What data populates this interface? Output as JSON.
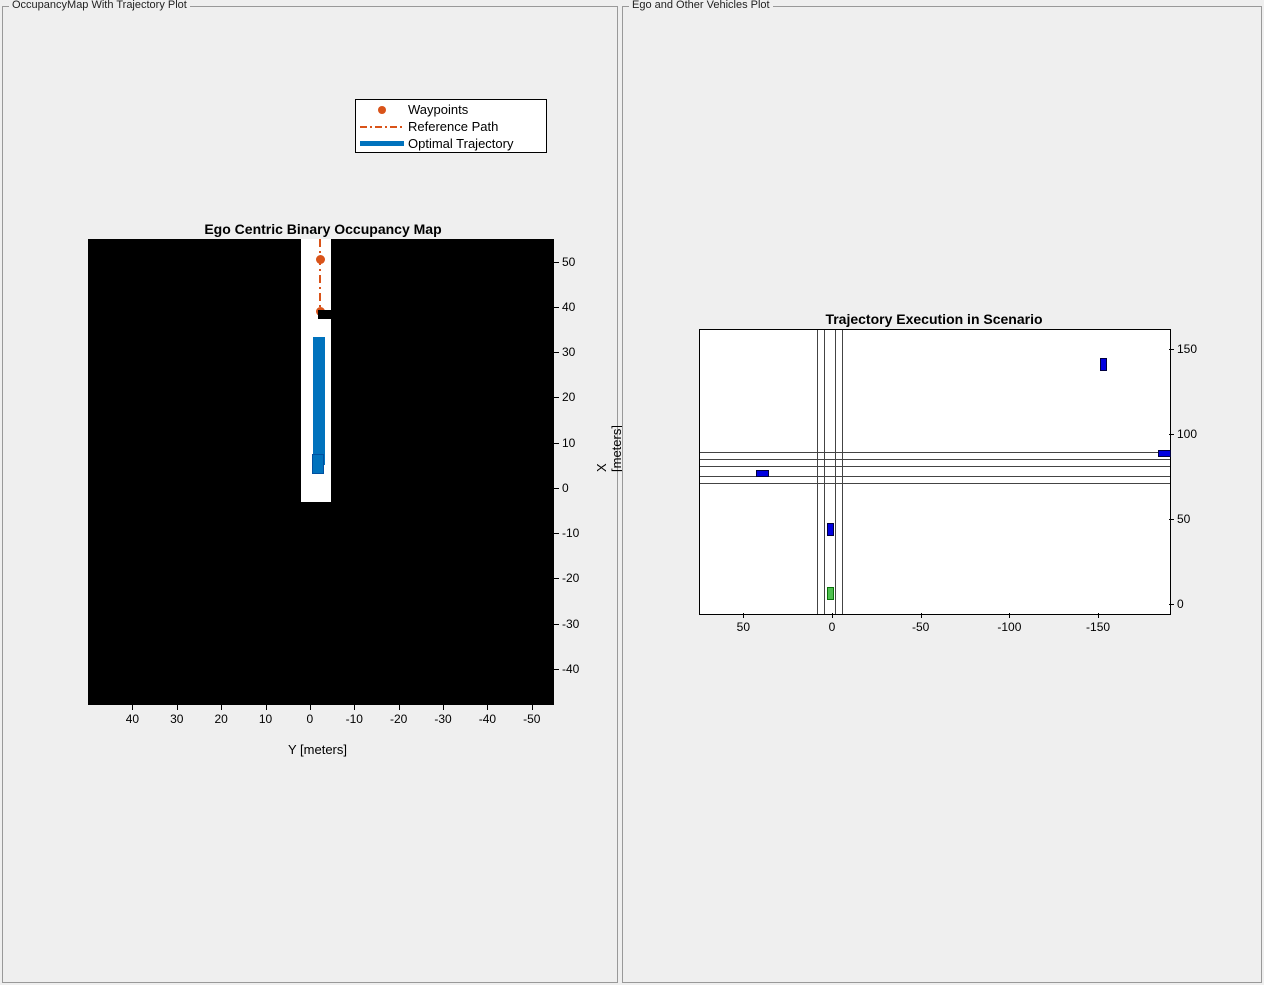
{
  "panels": {
    "left_title": "OccupancyMap With Trajectory Plot",
    "right_title": "Ego and Other Vehicles Plot"
  },
  "legend": {
    "items": [
      "Waypoints",
      "Reference Path",
      "Optimal Trajectory"
    ]
  },
  "occupancy": {
    "title": "Ego Centric Binary Occupancy Map",
    "xlabel": "Y [meters]",
    "ylabel": "X [meters]",
    "x_ticks": [
      "40",
      "30",
      "20",
      "10",
      "0",
      "-10",
      "-20",
      "-30",
      "-40",
      "-50"
    ],
    "y_ticks": [
      "50",
      "40",
      "30",
      "20",
      "10",
      "0",
      "-10",
      "-20",
      "-30",
      "-40"
    ]
  },
  "scenario": {
    "title": "Trajectory Execution in Scenario",
    "x_ticks": [
      "50",
      "0",
      "-50",
      "-100",
      "-150"
    ],
    "y_ticks": [
      "0",
      "50",
      "100",
      "150"
    ]
  },
  "chart_data": [
    {
      "type": "heatmap",
      "title": "Ego Centric Binary Occupancy Map",
      "xlabel": "Y [meters]",
      "ylabel": "X [meters]",
      "xlim": [
        50,
        -55
      ],
      "ylim": [
        -48,
        55
      ],
      "note": "Binary occupancy grid: white=free, black=occupied; Y decreases left→right, X increases bottom→top",
      "free_region": {
        "y_min": -4,
        "y_max": 2,
        "x_min": -2,
        "x_max": 55
      },
      "overlays": {
        "waypoints_xy": [
          [
            52,
            -2
          ],
          [
            40,
            -2
          ]
        ],
        "reference_path_xy": [
          [
            55,
            -2
          ],
          [
            36,
            -2
          ]
        ],
        "optimal_trajectory_xy": [
          [
            33,
            -2
          ],
          [
            5,
            -2
          ]
        ],
        "ego_vehicle_xy": [
          5,
          -2
        ]
      },
      "legend": [
        "Waypoints",
        "Reference Path",
        "Optimal Trajectory"
      ]
    },
    {
      "type": "scatter",
      "title": "Trajectory Execution in Scenario",
      "xlabel": "",
      "ylabel": "",
      "xlim": [
        75,
        -190
      ],
      "ylim": [
        -5,
        162
      ],
      "note": "Bird's-eye scenario; X decreases left→right",
      "roads": {
        "vertical_lane_x": [
          -5,
          -1,
          5,
          9
        ],
        "horizontal_lane_y": [
          72,
          76,
          82,
          86,
          90
        ]
      },
      "series": [
        {
          "name": "ego",
          "color": "green",
          "points_xy": [
            [
              2,
              7
            ]
          ]
        },
        {
          "name": "other_vehicles",
          "color": "blue",
          "points_xy": [
            [
              2,
              45
            ],
            [
              40,
              78
            ],
            [
              -152,
              141
            ],
            [
              -186,
              90
            ]
          ]
        }
      ]
    }
  ]
}
